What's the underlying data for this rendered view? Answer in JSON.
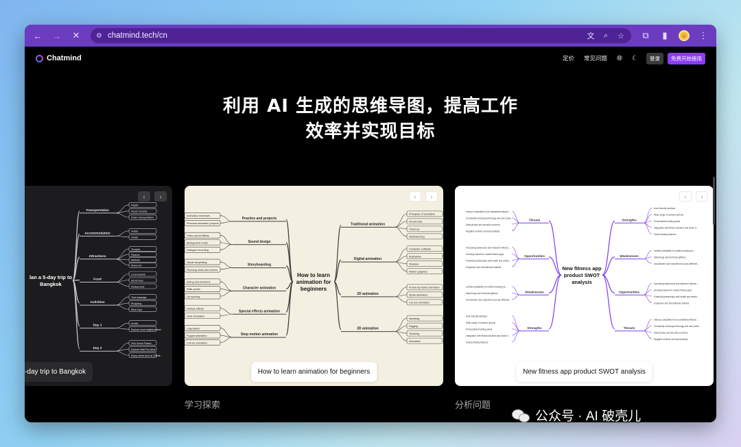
{
  "browser": {
    "url": "chatmind.tech/cn",
    "icons": [
      "back-arrow-icon",
      "forward-arrow-icon",
      "stop-loading-icon",
      "site-settings-icon",
      "translate-icon",
      "zoom-icon",
      "bookmark-star-icon",
      "extensions-icon",
      "side-panel-icon",
      "profile-avatar",
      "kebab-menu-icon"
    ]
  },
  "nav": {
    "brand": "Chatmind",
    "pricing": "定价",
    "faq": "常见问题",
    "login": "登录",
    "free_trial": "免费开始使用"
  },
  "hero": {
    "line1": "利用 AI 生成的思维导图，提高工作",
    "line2": "效率并实现目标"
  },
  "cards": [
    {
      "caption": "-day trip to Bangkok",
      "center": [
        "lan a 5-day trip to",
        "Bangkok"
      ],
      "branches": [
        {
          "label": "Transportation",
          "items": [
            "Flights",
            "Airport transfer",
            "Public transportation"
          ]
        },
        {
          "label": "Accommodation",
          "items": [
            "Hotels",
            "Hotels"
          ]
        },
        {
          "label": "Attractions",
          "items": [
            "Temples",
            "Palaces",
            "Markets",
            "Museums"
          ]
        },
        {
          "label": "Food",
          "items": [
            "Local cuisine",
            "Street food",
            "Restaurants"
          ]
        },
        {
          "label": "Activities",
          "items": [
            "Thai massage",
            "Shopping",
            "River trips"
          ]
        },
        {
          "label": "Day 1",
          "items": [
            "Arrival",
            "Explore local neighborhood"
          ]
        },
        {
          "label": "Day 2",
          "items": [
            "Visit Grand Palace",
            "Explore Wat Pho Area",
            "Enjoy street food at Chinatown"
          ]
        }
      ]
    },
    {
      "caption": "How to learn animation for beginners",
      "center": [
        "How to learn",
        "animation for",
        "beginners"
      ],
      "left": [
        {
          "label": "Practice and projects",
          "items": [
            "Animation exercises",
            "Personal animation projects"
          ]
        },
        {
          "label": "Sound design",
          "items": [
            "Foley sound effects",
            "Background music",
            "Dialogue recording"
          ]
        },
        {
          "label": "Storyboarding",
          "items": [
            "Visual storytelling",
            "Planning shots and scenes"
          ]
        },
        {
          "label": "Character animation",
          "items": [
            "Acting and emotions",
            "Walk cycles",
            "Lip syncing"
          ]
        },
        {
          "label": "Special effects animation",
          "items": [
            "Particle effects",
            "Fluid simulation"
          ]
        },
        {
          "label": "Stop motion animation",
          "items": [
            "Claymation",
            "Puppet animation",
            "Cut-out animation"
          ]
        }
      ],
      "right": [
        {
          "label": "Traditional animation",
          "items": [
            "Principles of animation",
            "Pencil tests",
            "Clean-up",
            "Inbetweening"
          ]
        },
        {
          "label": "Digital animation",
          "items": [
            "Computer software",
            "Keyframes",
            "Timeline",
            "Motion graphics"
          ]
        },
        {
          "label": "2D animation",
          "items": [
            "Frame-by-frame animation",
            "Sprite animation",
            "Cut-out animation"
          ]
        },
        {
          "label": "3D animation",
          "items": [
            "Modeling",
            "Rigging",
            "Texturing",
            "Animation"
          ]
        }
      ]
    },
    {
      "caption": "New fitness app product SWOT analysis",
      "center": [
        "New fitness app",
        "product SWOT",
        "analysis"
      ],
      "left": [
        {
          "label": "Threats",
          "items": [
            "Intense competition from established fitness app brands",
            "Constantly evolving technology and user preferences",
            "Data privacy and security concerns",
            "Negative reviews and bad publicity"
          ]
        },
        {
          "label": "Opportunities",
          "items": [
            "Increasing awareness and interest in fitness and wellness",
            "Growing market for mobile fitness apps",
            "Potential partnerships with health and wellness brands",
            "Expansion into international markets"
          ]
        },
        {
          "label": "Weaknesses",
          "items": [
            "Limited availability of nutrition tracking features",
            "Initial bugs and technical glitches",
            "Inconsistent user experience across different devices"
          ]
        },
        {
          "label": "Strengths",
          "items": [
            "User-friendly interface",
            "Wide range of workout options",
            "Personalized training plans",
            "Integration with fitness trackers and smart devices",
            "Social sharing features"
          ]
        }
      ],
      "right": [
        {
          "label": "Strengths",
          "items": [
            "User-friendly interface",
            "Wide range of workout options",
            "Personalized training plans",
            "Integration with fitness trackers and smart devices",
            "Social sharing features"
          ]
        },
        {
          "label": "Weaknesses",
          "items": [
            "Limited availability of nutrition tracking features",
            "Initial bugs and technical glitches",
            "Inconsistent user experience across different devices"
          ]
        },
        {
          "label": "Opportunities",
          "items": [
            "Increasing awareness and interest in fitness and wellness",
            "Growing market for mobile fitness apps",
            "Potential partnerships with health and wellness brands",
            "Expansion into international markets"
          ]
        },
        {
          "label": "Threats",
          "items": [
            "Intense competition from established fitness app brands",
            "Constantly evolving technology and user preferences",
            "Data privacy and security concerns",
            "Negative reviews and bad publicity"
          ]
        }
      ]
    }
  ],
  "sections": [
    "学习探索",
    "分析问题"
  ],
  "watermark": "公众号 · AI 破壳儿",
  "colors": {
    "frame": "#6b3bc0",
    "accent": "#8b3df5",
    "fitness_line": "#7c3aed"
  }
}
